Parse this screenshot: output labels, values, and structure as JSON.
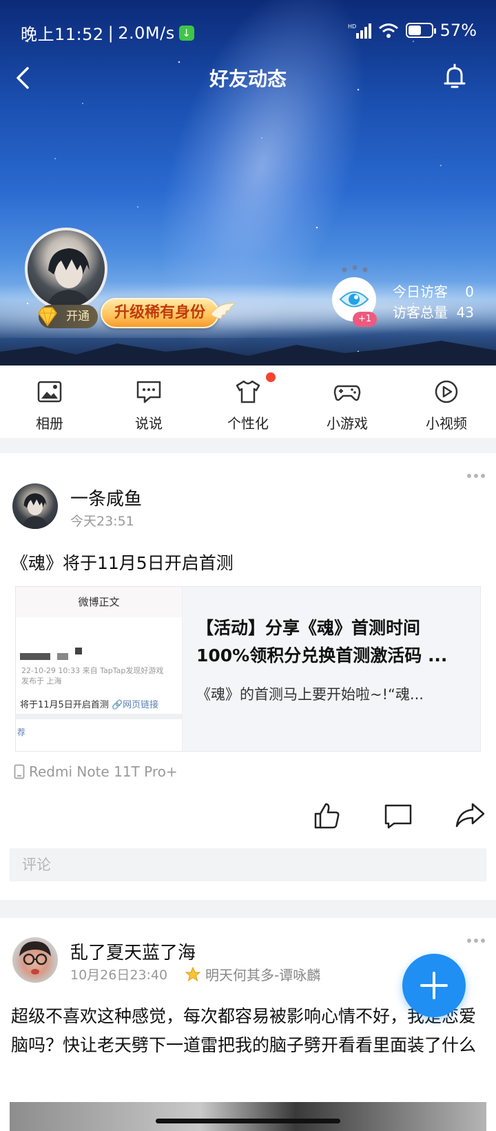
{
  "status_bar": {
    "time": "晚上11:52",
    "speed": "2.0M/s",
    "battery": "57%",
    "battery_level": 0.57
  },
  "nav": {
    "title": "好友动态"
  },
  "profile": {
    "vip_open": "开通",
    "upgrade_badge": "升级稀有身份",
    "visitor_badge": "+1",
    "today_visitors_label": "今日访客",
    "today_visitors_value": "0",
    "total_visitors_label": "访客总量",
    "total_visitors_value": "43"
  },
  "quickmenu": [
    {
      "label": "相册",
      "icon": "photo-album-icon"
    },
    {
      "label": "说说",
      "icon": "message-bubble-icon"
    },
    {
      "label": "个性化",
      "icon": "tshirt-icon"
    },
    {
      "label": "小游戏",
      "icon": "gamepad-icon"
    },
    {
      "label": "小视频",
      "icon": "play-circle-icon"
    }
  ],
  "post1": {
    "name": "一条咸鱼",
    "time": "今天23:51",
    "text": "《魂》将于11月5日开启首测",
    "card": {
      "thumb_header": "微博正文",
      "thumb_meta_line1": "22-10-29 10:33  来自 TapTap发现好游戏",
      "thumb_meta_line2": "发布于 上海",
      "thumb_line": "将于11月5日开启首测",
      "thumb_link": "网页链接",
      "thumb_rec": "荐",
      "title_line1": "【活动】分享《魂》首测时间",
      "title_line2": "100%领积分兑换首测激活码 ...",
      "desc": "《魂》的首测马上要开始啦~!“魂..."
    },
    "device": "Redmi Note 11T Pro+",
    "comment_placeholder": "评论"
  },
  "post2": {
    "name": "乱了夏天蓝了海",
    "time": "10月26日23:40",
    "tag": "明天何其多-谭咏麟",
    "text": "超级不喜欢这种感觉，每次都容易被影响心情不好，我是恋爱脑吗？快让老天劈下一道雷把我的脑子劈开看看里面装了什么"
  },
  "colors": {
    "accent": "#1f8ff4",
    "notification_dot": "#f4442e",
    "vip_gold": "#ffc35a"
  }
}
